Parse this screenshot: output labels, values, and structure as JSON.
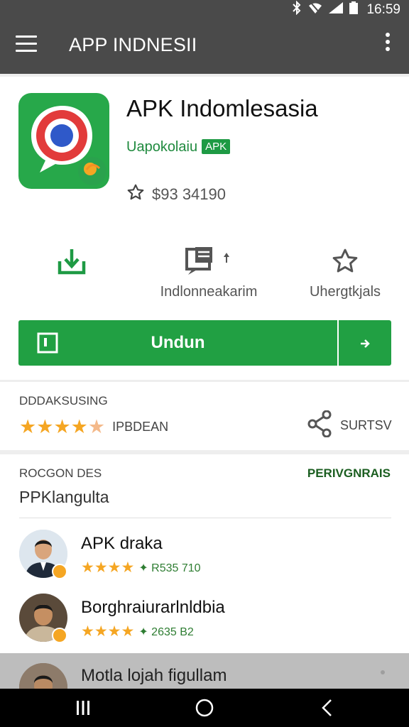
{
  "status_bar": {
    "time": "16:59",
    "icons": [
      "bluetooth-icon",
      "wifi-off-icon",
      "signal-icon",
      "battery-icon"
    ]
  },
  "app_bar": {
    "title": "APP INDNESII",
    "icons": [
      "hamburger-menu-icon",
      "more-vert-icon"
    ]
  },
  "app": {
    "name": "APK Indomlesasia",
    "developer": "Uapokolaiu",
    "developer_badge": "APK",
    "price": "$93 34190"
  },
  "actions": [
    {
      "icon": "download-icon",
      "label": ""
    },
    {
      "icon": "message-icon",
      "label": "Indlonneakarim"
    },
    {
      "icon": "star-outline-icon",
      "label": "Uhergtkjals"
    }
  ],
  "install": {
    "label": "Undun",
    "icon": "install-icon",
    "more_icon": "arrow-right-icon"
  },
  "rating": {
    "heading": "DDDAKSUSING",
    "count_label": "IPBDEAN",
    "stars": 4.5,
    "share_label": "SURTSV"
  },
  "reviews": {
    "heading": "ROCGON DES",
    "link": "PERIVGNRAIS",
    "subheading": "PPKlangulta",
    "items": [
      {
        "name": "APK draka",
        "stars": 4,
        "meta": "R535 710"
      },
      {
        "name": "Borghraiurarlnldbia",
        "stars": 4,
        "meta": "2635 B2"
      },
      {
        "name": "Motla lojah figullam"
      }
    ]
  },
  "nav_bar": {
    "buttons": [
      "recents-icon",
      "home-icon",
      "back-icon"
    ]
  },
  "colors": {
    "app_bar": "#4a4a4a",
    "accent_green": "#21a043",
    "star": "#f5a623"
  }
}
